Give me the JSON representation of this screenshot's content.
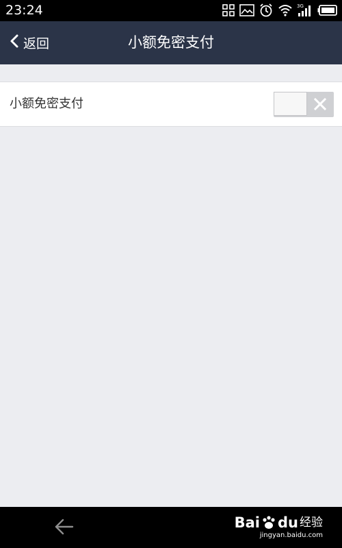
{
  "status_bar": {
    "time": "23:24",
    "network_label": "3G",
    "icons": [
      "qr-code-icon",
      "image-icon",
      "alarm-icon",
      "wifi-icon",
      "signal-icon",
      "battery-icon"
    ]
  },
  "nav": {
    "back_label": "返回",
    "title": "小额免密支付"
  },
  "settings": {
    "row_label": "小额免密支付",
    "toggle_state": "off"
  },
  "watermark": {
    "brand": "Bai",
    "brand_suffix": "du",
    "product": "经验",
    "url": "jingyan.baidu.com"
  },
  "colors": {
    "nav_bg": "#2b3448",
    "page_bg": "#ecedf1",
    "status_bg": "#000000"
  }
}
